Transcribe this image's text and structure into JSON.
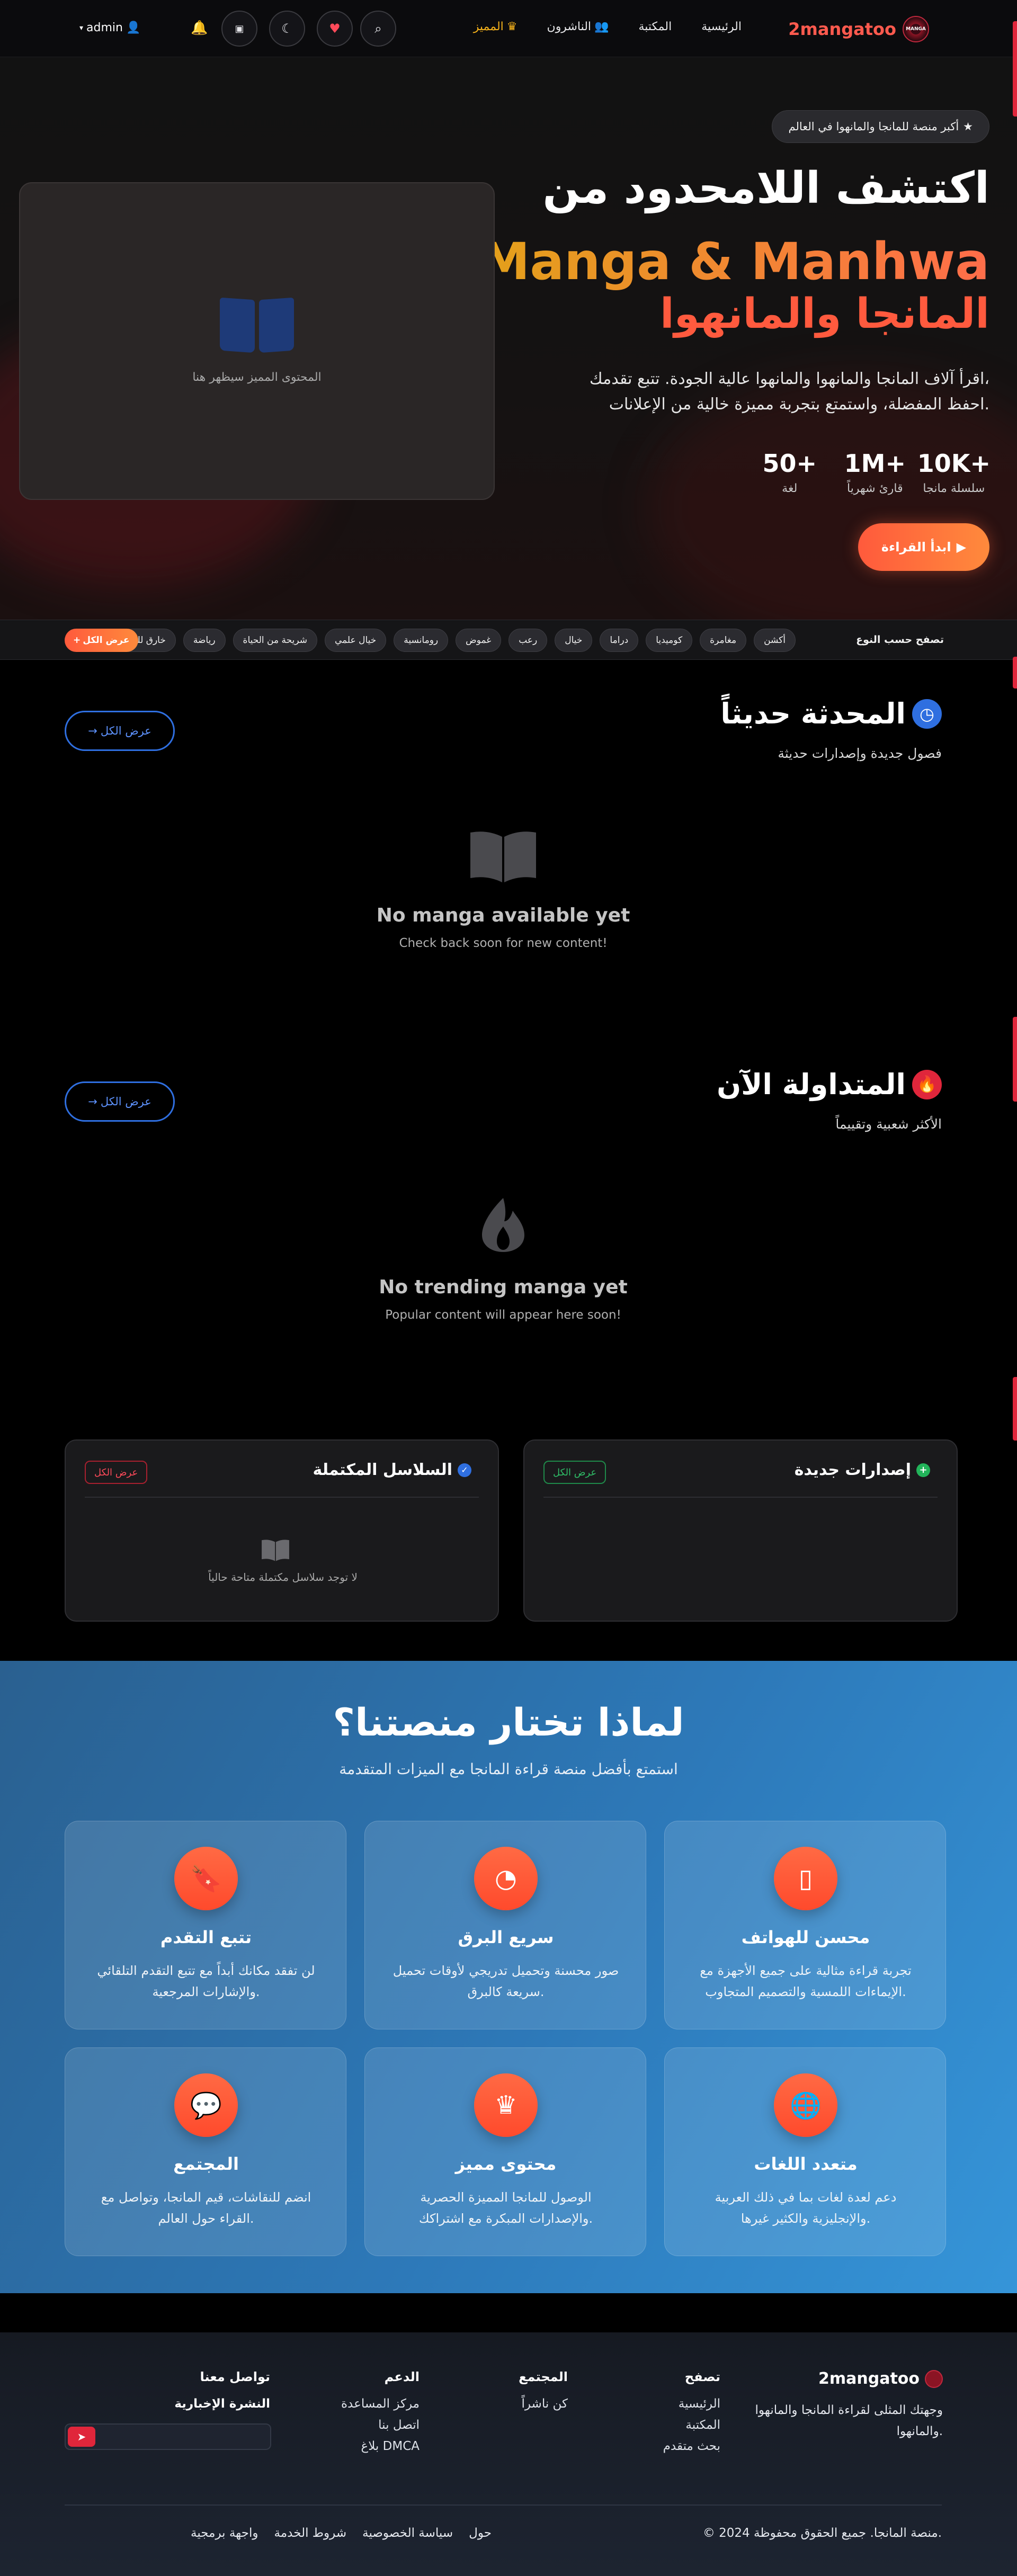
{
  "header": {
    "brand": "2mangatoo",
    "logo_text": "MANGA",
    "nav": [
      {
        "label": "الرئيسية"
      },
      {
        "label": "المكتبة"
      },
      {
        "label": "الناشرون"
      },
      {
        "label": "المميز"
      }
    ],
    "admin_label": "admin",
    "accent": "#ff5a4e"
  },
  "hero": {
    "badge": "أكبر منصة للمانجا والمانهوا في العالم",
    "title1": "اكتشف اللامحدود من",
    "title2": "Manga & Manhwa",
    "title3": "المانجا والمانهوا",
    "desc1": "اقرأ آلاف المانجا والمانهوا والمانهوا عالية الجودة. تتبع تقدمك،",
    "desc2": "احفظ المفضلة، واستمتع بتجربة مميزة خالية من الإعلانات.",
    "stats": [
      {
        "num": "10K+",
        "label": "سلسلة مانجا"
      },
      {
        "num": "1M+",
        "label": "قارئ شهرياً"
      },
      {
        "num": "50+",
        "label": "لغة"
      }
    ],
    "cta": "ابدأ القراءة",
    "featured_placeholder": "المحتوى المميز سيظهر هنا"
  },
  "genres": {
    "label": "تصفح حسب النوع",
    "items": [
      "أكشن",
      "مغامرة",
      "كوميديا",
      "دراما",
      "خيال",
      "رعب",
      "غموض",
      "رومانسية",
      "خيال علمي",
      "شريحة من الحياة",
      "رياضة",
      "خارق للطبيعة"
    ],
    "view_all": "عرض الكل"
  },
  "latest": {
    "title": "المحدثة حديثاً",
    "subtitle": "فصول جديدة وإصدارات حديثة",
    "view_all": "عرض الكل",
    "empty_title": "No manga available yet",
    "empty_sub": "Check back soon for new content!"
  },
  "trending": {
    "title": "المتداولة الآن",
    "subtitle": "الأكثر شعبية وتقييماً",
    "view_all": "عرض الكل",
    "empty_title": "No trending manga yet",
    "empty_sub": "Popular content will appear here soon!"
  },
  "completed": {
    "title": "السلاسل المكتملة",
    "view_all": "عرض الكل",
    "empty": "لا توجد سلاسل مكتملة متاحة حالياً"
  },
  "new_releases": {
    "title": "إصدارات جديدة",
    "view_all": "عرض الكل"
  },
  "why": {
    "title": "لماذا تختار منصتنا؟",
    "subtitle": "استمتع بأفضل منصة قراءة المانجا مع الميزات المتقدمة",
    "features": [
      {
        "icon": "mobile-icon",
        "title": "محسن للهواتف",
        "desc": "تجربة قراءة مثالية على جميع الأجهزة مع الإيماءات اللمسية والتصميم المتجاوب."
      },
      {
        "icon": "speed-icon",
        "title": "سريع البرق",
        "desc": "صور محسنة وتحميل تدريجي لأوقات تحميل سريعة كالبرق."
      },
      {
        "icon": "bookmark-icon",
        "title": "تتبع التقدم",
        "desc": "لن تفقد مكانك أبداً مع تتبع التقدم التلقائي والإشارات المرجعية."
      },
      {
        "icon": "globe-icon",
        "title": "متعدد اللغات",
        "desc": "دعم لعدة لغات بما في ذلك العربية والإنجليزية والكثير غيرها."
      },
      {
        "icon": "crown-icon",
        "title": "محتوى مميز",
        "desc": "الوصول للمانجا المميزة الحصرية والإصدارات المبكرة مع اشتراكك."
      },
      {
        "icon": "chat-icon",
        "title": "المجتمع",
        "desc": "انضم للنقاشات، قيم المانجا، وتواصل مع القراء حول العالم."
      }
    ]
  },
  "footer": {
    "brand": "2mangatoo",
    "desc": "وجهتك المثلى لقراءة المانجا والمانهوا والمانهوا.",
    "cols": [
      {
        "title": "تصفح",
        "links": [
          "الرئيسية",
          "المكتبة",
          "بحث متقدم"
        ]
      },
      {
        "title": "المجتمع",
        "links": [
          "كن ناشراً"
        ]
      },
      {
        "title": "الدعم",
        "links": [
          "مركز المساعدة",
          "اتصل بنا",
          "بلاغ DMCA"
        ]
      }
    ],
    "contact_title": "تواصل معنا",
    "newsletter_title": "النشرة الإخبارية",
    "copyright": "© 2024 منصة المانجا. جميع الحقوق محفوظة.",
    "links": [
      "حول",
      "سياسة الخصوصية",
      "شروط الخدمة",
      "واجهة برمجية"
    ]
  }
}
